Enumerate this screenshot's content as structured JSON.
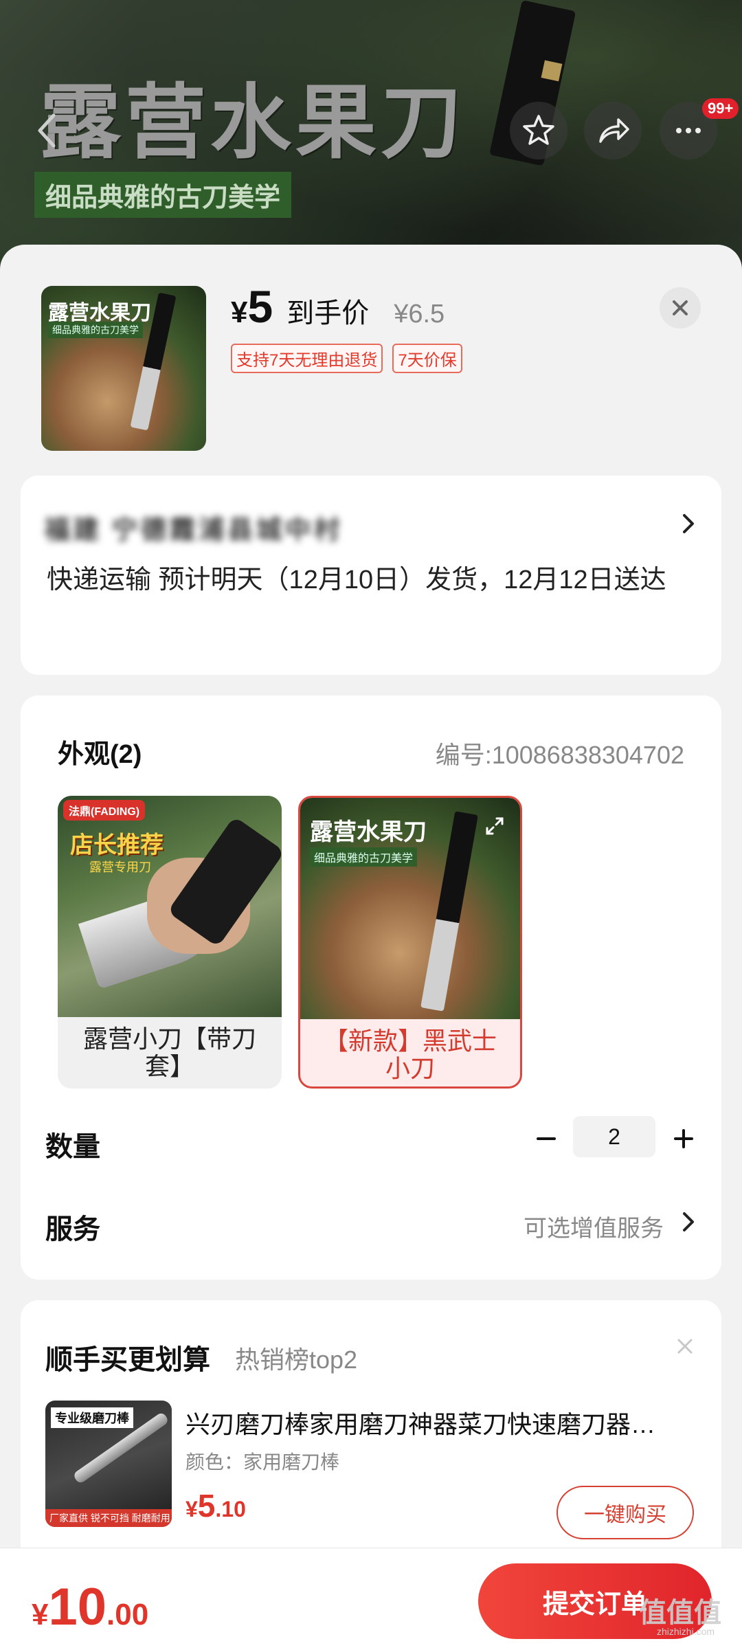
{
  "hero": {
    "title": "露营水果刀",
    "subtitle": "细品典雅的古刀美学",
    "cart_badge": "99+",
    "icons": [
      "back-icon",
      "star-icon",
      "share-icon",
      "more-icon"
    ]
  },
  "product": {
    "thumb_title": "露营水果刀",
    "thumb_tag": "细品典雅的古刀美学",
    "currency": "¥",
    "price": "5",
    "price_label": "到手价",
    "original_price": "¥6.5",
    "tags": [
      "支持7天无理由退货",
      "7天价保"
    ]
  },
  "address": {
    "name": "福建 宁德霞浦县城中村",
    "shipping": "快递运输 预计明天（12月10日）发货，12月12日送达"
  },
  "spec": {
    "title": "外观(2)",
    "code": "编号:10086838304702",
    "options": [
      {
        "label": "露营小刀【带刀套】",
        "brand": "法鼎(FADING)",
        "promo": "店长推荐",
        "promo_sub": "露营专用刀",
        "selected": false
      },
      {
        "label": "【新款】黑武士小刀",
        "thumb_title": "露营水果刀",
        "thumb_sub": "细品典雅的古刀美学",
        "selected": true
      }
    ],
    "quantity_label": "数量",
    "quantity": "2",
    "service_label": "服务",
    "service_hint": "可选增值服务"
  },
  "recommend": {
    "title": "顺手买更划算",
    "subtitle": "热销榜top2",
    "item": {
      "thumb_title": "专业级磨刀棒",
      "thumb_bar": "厂家直供 锐不可挡 耐磨耐用",
      "name": "兴刃磨刀棒家用磨刀神器菜刀快速磨刀器…",
      "color": "颜色：家用磨刀棒",
      "price_yen": "¥",
      "price_int": "5",
      "price_dec": ".10",
      "buy_label": "一键购买"
    }
  },
  "footer": {
    "total_yen": "¥",
    "total_int": "10",
    "total_dec": ".00",
    "submit_label": "提交订单",
    "watermark": "值值值",
    "watermark_sub": "zhizhizhi.com"
  },
  "colors": {
    "accent": "#e0352a",
    "primary_button": "#e8302f"
  }
}
